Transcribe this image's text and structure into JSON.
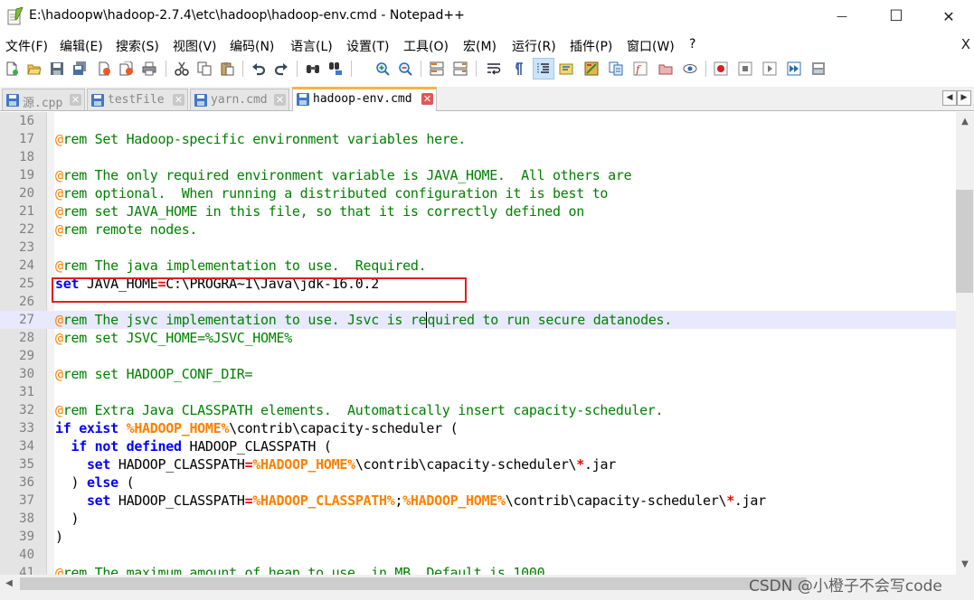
{
  "window": {
    "title": "E:\\hadoopw\\hadoop-2.7.4\\etc\\hadoop\\hadoop-env.cmd - Notepad++",
    "minimize_glyph": "—",
    "maximize_glyph": "☐",
    "close_glyph": "✕"
  },
  "menu": {
    "items": [
      "文件(F)",
      "编辑(E)",
      "搜索(S)",
      "视图(V)",
      "编码(N)",
      "语言(L)",
      "设置(T)",
      "工具(O)",
      "宏(M)",
      "运行(R)",
      "插件(P)",
      "窗口(W)",
      "?"
    ],
    "close_glyph": "X"
  },
  "toolbar": {
    "buttons": [
      "new-file",
      "open-file",
      "save",
      "save-all",
      "close",
      "close-all",
      "print",
      "cut",
      "copy",
      "paste",
      "undo",
      "redo",
      "find",
      "replace",
      "zoom-in",
      "zoom-out",
      "sync-vertical",
      "sync-horizontal",
      "word-wrap",
      "show-all-chars",
      "indent-guide",
      "udl",
      "doc-map",
      "function-list",
      "folder-workspace",
      "monitor",
      "record-macro",
      "stop-macro",
      "play-macro",
      "run-macro-multiple",
      "save-macro"
    ],
    "pressed": [
      "indent-guide"
    ]
  },
  "tabs": {
    "items": [
      {
        "label": "源.cpp",
        "active": false
      },
      {
        "label": "testFile",
        "active": false
      },
      {
        "label": "yarn.cmd",
        "active": false
      },
      {
        "label": "hadoop-env.cmd",
        "active": true
      }
    ],
    "close_glyph": "✕",
    "scroll_left_glyph": "◀",
    "scroll_right_glyph": "▶"
  },
  "editor": {
    "first_line": 16,
    "current_line": 27,
    "highlighted_line": 25,
    "lines": [
      [],
      [
        [
          "c",
          "@"
        ],
        [
          "m",
          "rem Set Hadoop-specific environment variables here."
        ]
      ],
      [],
      [
        [
          "c",
          "@"
        ],
        [
          "m",
          "rem The only required environment variable is JAVA_HOME.  All others are"
        ]
      ],
      [
        [
          "c",
          "@"
        ],
        [
          "m",
          "rem optional.  When running a distributed configuration it is best to"
        ]
      ],
      [
        [
          "c",
          "@"
        ],
        [
          "m",
          "rem set JAVA_HOME in this file, so that it is correctly defined on"
        ]
      ],
      [
        [
          "c",
          "@"
        ],
        [
          "m",
          "rem remote nodes."
        ]
      ],
      [],
      [
        [
          "c",
          "@"
        ],
        [
          "m",
          "rem The java implementation to use.  Required."
        ]
      ],
      [
        [
          "k",
          "set"
        ],
        [
          "t",
          " JAVA_HOME"
        ],
        [
          "o",
          "="
        ],
        [
          "t",
          "C:\\PROGRA~1\\Java\\jdk-16.0.2"
        ]
      ],
      [],
      [
        [
          "c",
          "@"
        ],
        [
          "m",
          "rem The jsvc implementation to use. Jsvc is re"
        ],
        [
          "m",
          "quired to run secure datanodes."
        ]
      ],
      [
        [
          "c",
          "@"
        ],
        [
          "m",
          "rem set JSVC_HOME=%JSVC_HOME%"
        ]
      ],
      [],
      [
        [
          "c",
          "@"
        ],
        [
          "m",
          "rem set HADOOP_CONF_DIR="
        ]
      ],
      [],
      [
        [
          "c",
          "@"
        ],
        [
          "m",
          "rem Extra Java CLASSPATH elements.  Automatically insert capacity-scheduler."
        ]
      ],
      [
        [
          "k",
          "if"
        ],
        [
          "t",
          " "
        ],
        [
          "k",
          "exist"
        ],
        [
          "t",
          " "
        ],
        [
          "v",
          "%HADOOP_HOME%"
        ],
        [
          "t",
          "\\contrib\\capacity-scheduler ("
        ]
      ],
      [
        [
          "t",
          "  "
        ],
        [
          "k",
          "if"
        ],
        [
          "t",
          " "
        ],
        [
          "k",
          "not"
        ],
        [
          "t",
          " "
        ],
        [
          "k",
          "defined"
        ],
        [
          "t",
          " HADOOP_CLASSPATH ("
        ]
      ],
      [
        [
          "t",
          "    "
        ],
        [
          "k",
          "set"
        ],
        [
          "t",
          " HADOOP_CLASSPATH"
        ],
        [
          "o",
          "="
        ],
        [
          "v",
          "%HADOOP_HOME%"
        ],
        [
          "t",
          "\\contrib\\capacity-scheduler\\"
        ],
        [
          "o",
          "*"
        ],
        [
          "t",
          ".jar"
        ]
      ],
      [
        [
          "t",
          "  ) "
        ],
        [
          "k",
          "else"
        ],
        [
          "t",
          " ("
        ]
      ],
      [
        [
          "t",
          "    "
        ],
        [
          "k",
          "set"
        ],
        [
          "t",
          " HADOOP_CLASSPATH"
        ],
        [
          "o",
          "="
        ],
        [
          "v",
          "%HADOOP_CLASSPATH%"
        ],
        [
          "t",
          ";"
        ],
        [
          "v",
          "%HADOOP_HOME%"
        ],
        [
          "t",
          "\\contrib\\capacity-scheduler\\"
        ],
        [
          "o",
          "*"
        ],
        [
          "t",
          ".jar"
        ]
      ],
      [
        [
          "t",
          "  )"
        ]
      ],
      [
        [
          "t",
          ")"
        ]
      ],
      [],
      [
        [
          "c",
          "@"
        ],
        [
          "m",
          "rem The maximum amount of heap to use, in MB. Default is 1000."
        ]
      ]
    ]
  },
  "watermark": "CSDN @小橙子不会写code",
  "colors": {
    "comment": "#008000",
    "keyword": "#0000ff",
    "variable": "#ff8000",
    "operator": "#ff0000",
    "current_line": "#e8e8ff",
    "highlight_box": "#e02020",
    "active_tab_accent": "#fab33f"
  }
}
